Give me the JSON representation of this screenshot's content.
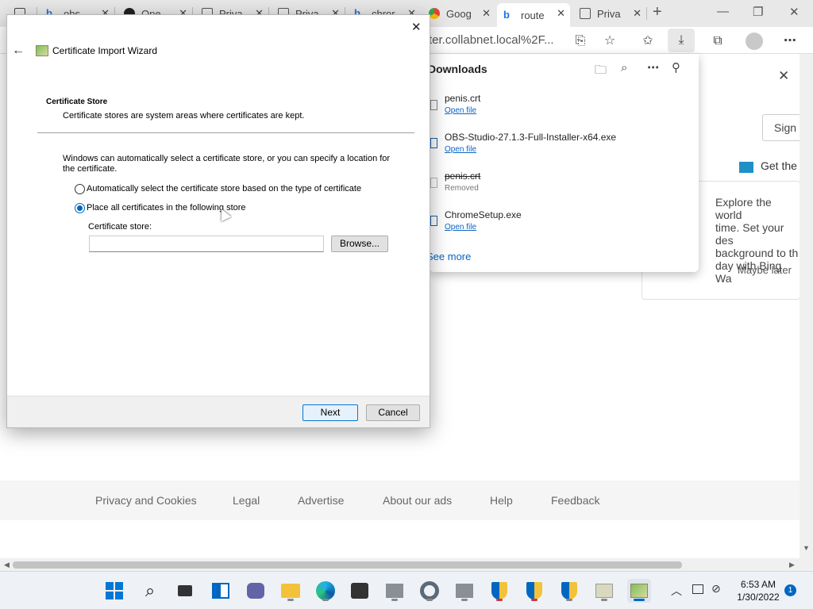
{
  "browser": {
    "tabs": [
      {
        "label": "obs",
        "icon": "bing-icon"
      },
      {
        "label": "Ope",
        "icon": "github-icon"
      },
      {
        "label": "Priva",
        "icon": "page-icon"
      },
      {
        "label": "Priva",
        "icon": "page-icon"
      },
      {
        "label": "chror",
        "icon": "bing-icon"
      },
      {
        "label": "Goog",
        "icon": "chrome-icon"
      },
      {
        "label": "route",
        "icon": "bing-icon"
      },
      {
        "label": "Priva",
        "icon": "page-icon"
      }
    ],
    "address_text": "ter.collabnet.local%2F..."
  },
  "downloads": {
    "title": "Downloads",
    "items": [
      {
        "name": "penis.crt",
        "action": "Open file",
        "removed": false
      },
      {
        "name": "OBS-Studio-27.1.3-Full-Installer-x64.exe",
        "action": "Open file",
        "removed": false
      },
      {
        "name": "penis.crt",
        "action": "Removed",
        "removed": true
      },
      {
        "name": "ChromeSetup.exe",
        "action": "Open file",
        "removed": false
      }
    ],
    "see_more": "See more"
  },
  "bing": {
    "sign_in": "Sign i",
    "get_the": "Get the",
    "explore": [
      "Explore the world",
      "time. Set your des",
      "background to th",
      "day with Bing Wa"
    ],
    "maybe_later": "Maybe later"
  },
  "footer": {
    "links": [
      "Privacy and Cookies",
      "Legal",
      "Advertise",
      "About our ads",
      "Help",
      "Feedback"
    ]
  },
  "wizard": {
    "title": "Certificate Import Wizard",
    "section_title": "Certificate Store",
    "section_desc": "Certificate stores are system areas where certificates are kept.",
    "intro_line1": "Windows can automatically select a certificate store, or you can specify a location for",
    "intro_line2": "the certificate.",
    "option_auto": "Automatically select the certificate store based on the type of certificate",
    "option_manual": "Place all certificates in the following store",
    "store_label": "Certificate store:",
    "store_value": "",
    "browse_label": "Browse...",
    "next_label": "Next",
    "cancel_label": "Cancel",
    "selected_option": "manual"
  },
  "taskbar": {
    "time": "6:53 AM",
    "date": "1/30/2022",
    "notification_count": "1"
  },
  "colors": {
    "accent": "#0067c0",
    "link": "#0a64c8"
  }
}
